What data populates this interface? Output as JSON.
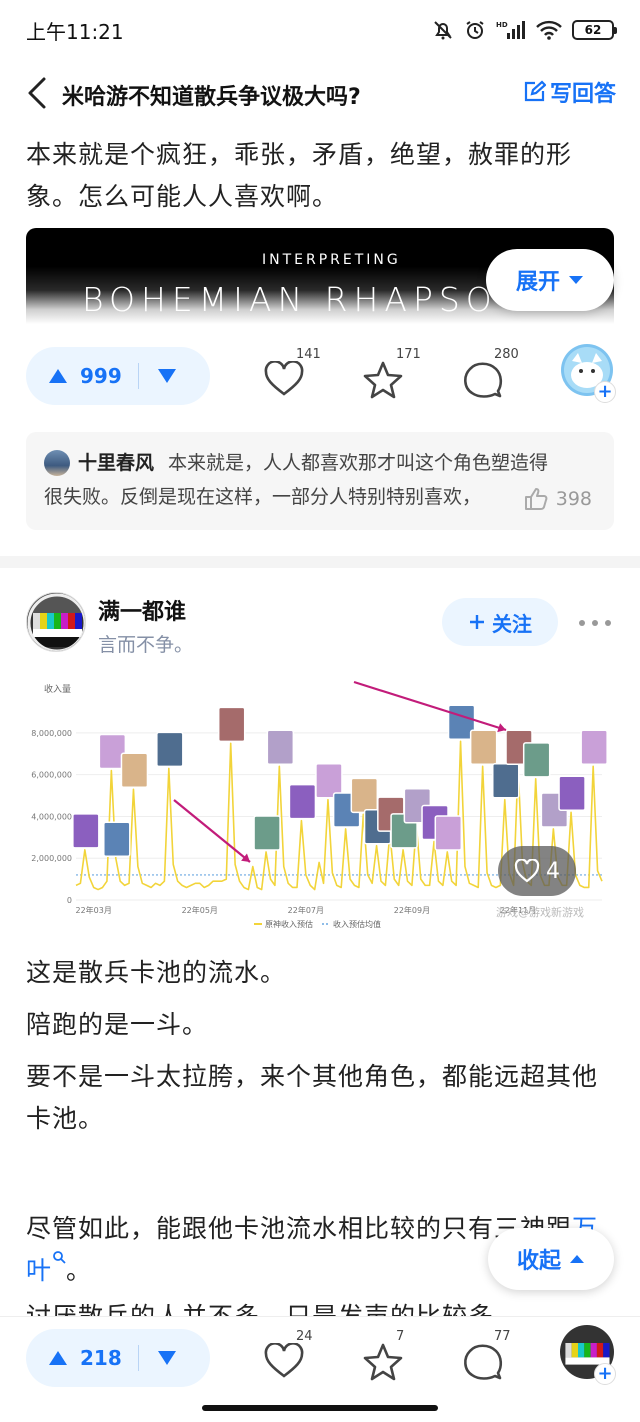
{
  "status_bar": {
    "time": "上午11:21",
    "battery": "62",
    "network": "HD"
  },
  "header": {
    "title": "米哈游不知道散兵争议极大吗?",
    "write_answer": "写回答"
  },
  "answer1": {
    "text": "本来就是个疯狂，乖张，矛盾，绝望，赦罪的形象。怎么可能人人喜欢啊。",
    "banner_small": "INTERPRETING",
    "banner_big": "BOHEMIAN RHAPSO",
    "expand_label": "展开",
    "votes": "999",
    "likes": "141",
    "favorites": "171",
    "comments": "280",
    "comment_preview": {
      "author": "十里春风",
      "line1": "本来就是，人人都喜欢那才叫这个角色塑造得",
      "line2": "很失败。反倒是现在这样，一部分人特别特别喜欢，",
      "likes": "398"
    }
  },
  "answer2": {
    "author": "满一都谁",
    "bio": "言而不争。",
    "follow_label": "关注",
    "image_like_count": "4",
    "paragraphs": [
      "这是散兵卡池的流水。",
      "陪跑的是一斗。",
      "要不是一斗太拉胯，来个其他角色，都能远超其他卡池。"
    ],
    "p4_text": "尽管如此，能跟他卡池流水相比较的只有三神跟",
    "p4_link": "万叶",
    "p4_end": "。",
    "p5_partial": "讨厌散兵的人并不多，只是发声的比较多。",
    "collapse_label": "收起",
    "votes": "218",
    "likes": "24",
    "favorites": "7",
    "comments": "77"
  },
  "chart_data": {
    "type": "line",
    "ylabel": "收入量",
    "yticks": [
      "8,000,000",
      "6,000,000",
      "4,000,000",
      "2,000,000",
      "0"
    ],
    "ylim": [
      0,
      9000000
    ],
    "xticks": [
      "22年03月",
      "22年05月",
      "22年07月",
      "22年09月",
      "22年11月"
    ],
    "legend": [
      "原神收入预估",
      "收入预估均值"
    ],
    "watermark": "游戏@游戏新游戏",
    "average": 1200000,
    "series": [
      {
        "name": "原神收入预估",
        "x": [
          0,
          1,
          2,
          3,
          4,
          5,
          6,
          7,
          8,
          9,
          10,
          11,
          12,
          13,
          14,
          15,
          16,
          17,
          18,
          19,
          20,
          21,
          22,
          23,
          24,
          25,
          26,
          27,
          28,
          29,
          30,
          31,
          32,
          33,
          34,
          35,
          36,
          37,
          38,
          39,
          40,
          41,
          42,
          43,
          44,
          45,
          46,
          47,
          48,
          49,
          50,
          51,
          52,
          53,
          54,
          55,
          56,
          57,
          58,
          59,
          60,
          61,
          62,
          63,
          64,
          65,
          66,
          67,
          68,
          69,
          70,
          71,
          72,
          73,
          74,
          75,
          76,
          77,
          78,
          79,
          80,
          81,
          82,
          83,
          84,
          85,
          86,
          87,
          88,
          89,
          90,
          91,
          92,
          93,
          94,
          95,
          96,
          97,
          98,
          99,
          100,
          101,
          102,
          103,
          104,
          105,
          106,
          107,
          108,
          109,
          110,
          111,
          112,
          113,
          114,
          115,
          116,
          117,
          118,
          119
        ],
        "y": [
          700000,
          800000,
          2400000,
          1100000,
          600000,
          500000,
          600000,
          900000,
          6200000,
          2000000,
          900000,
          700000,
          800000,
          5300000,
          1600000,
          800000,
          700000,
          600000,
          800000,
          700000,
          900000,
          6300000,
          1700000,
          900000,
          700000,
          600000,
          700000,
          800000,
          800000,
          600000,
          700000,
          900000,
          900000,
          900000,
          1000000,
          7500000,
          1700000,
          900000,
          600000,
          500000,
          1600000,
          600000,
          500000,
          2300000,
          1000000,
          700000,
          6400000,
          1600000,
          800000,
          600000,
          600000,
          3800000,
          1200000,
          700000,
          500000,
          1800000,
          800000,
          4800000,
          1300000,
          700000,
          600000,
          3400000,
          1000000,
          700000,
          600000,
          4100000,
          1200000,
          800000,
          2600000,
          900000,
          700000,
          3200000,
          1000000,
          700000,
          2400000,
          900000,
          700000,
          3600000,
          1000000,
          700000,
          700000,
          2800000,
          900000,
          700000,
          2300000,
          900000,
          700000,
          7600000,
          1600000,
          800000,
          700000,
          600000,
          6400000,
          1300000,
          700000,
          600000,
          700000,
          4800000,
          1300000,
          700000,
          6400000,
          1800000,
          900000,
          700000,
          5800000,
          1200000,
          700000,
          700000,
          3400000,
          1100000,
          700000,
          700000,
          4200000,
          1200000,
          700000,
          600000,
          600000,
          6400000,
          1400000,
          900000
        ]
      }
    ]
  }
}
